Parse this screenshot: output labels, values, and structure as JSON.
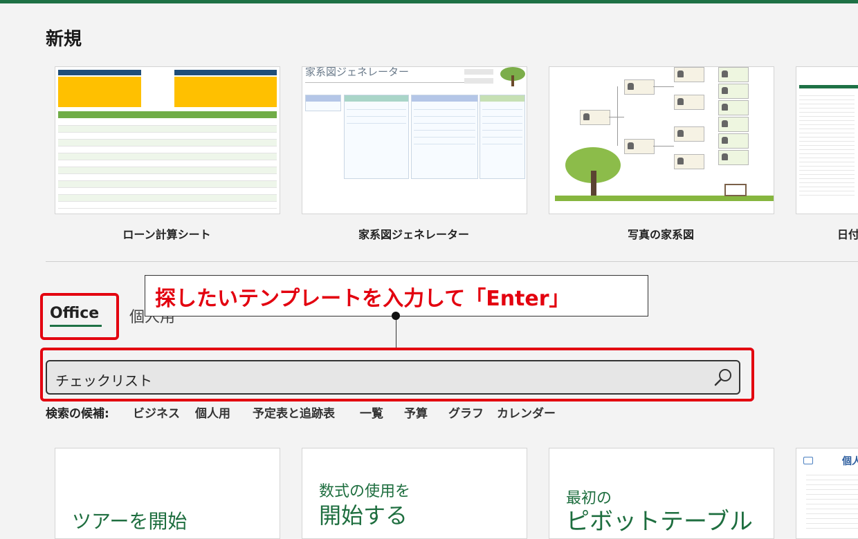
{
  "section_title": "新規",
  "featured_templates": [
    {
      "name": "ローン計算シート"
    },
    {
      "name": "家系図ジェネレーター",
      "thumb_title": "家系図ジェネレーター"
    },
    {
      "name": "写真の家系図"
    },
    {
      "name": "日付"
    }
  ],
  "tabs": {
    "office": "Office",
    "personal": "個人用"
  },
  "callout": "探したいテンプレートを入力して「Enter」",
  "search": {
    "value": "チェックリスト"
  },
  "suggestions": {
    "label": "検索の候補:",
    "items": [
      "ビジネス",
      "個人用",
      "予定表と追跡表",
      "一覧",
      "予算",
      "グラフ",
      "カレンダー"
    ]
  },
  "bottom_templates": [
    {
      "line1": "ツアーを開始"
    },
    {
      "line1": "数式の使用を",
      "line2": "開始する"
    },
    {
      "line1": "最初の",
      "line2": "ピボットテーブル"
    },
    {
      "line1": "個人"
    }
  ],
  "colors": {
    "accent": "#1e7145",
    "highlight": "#e3000f"
  }
}
